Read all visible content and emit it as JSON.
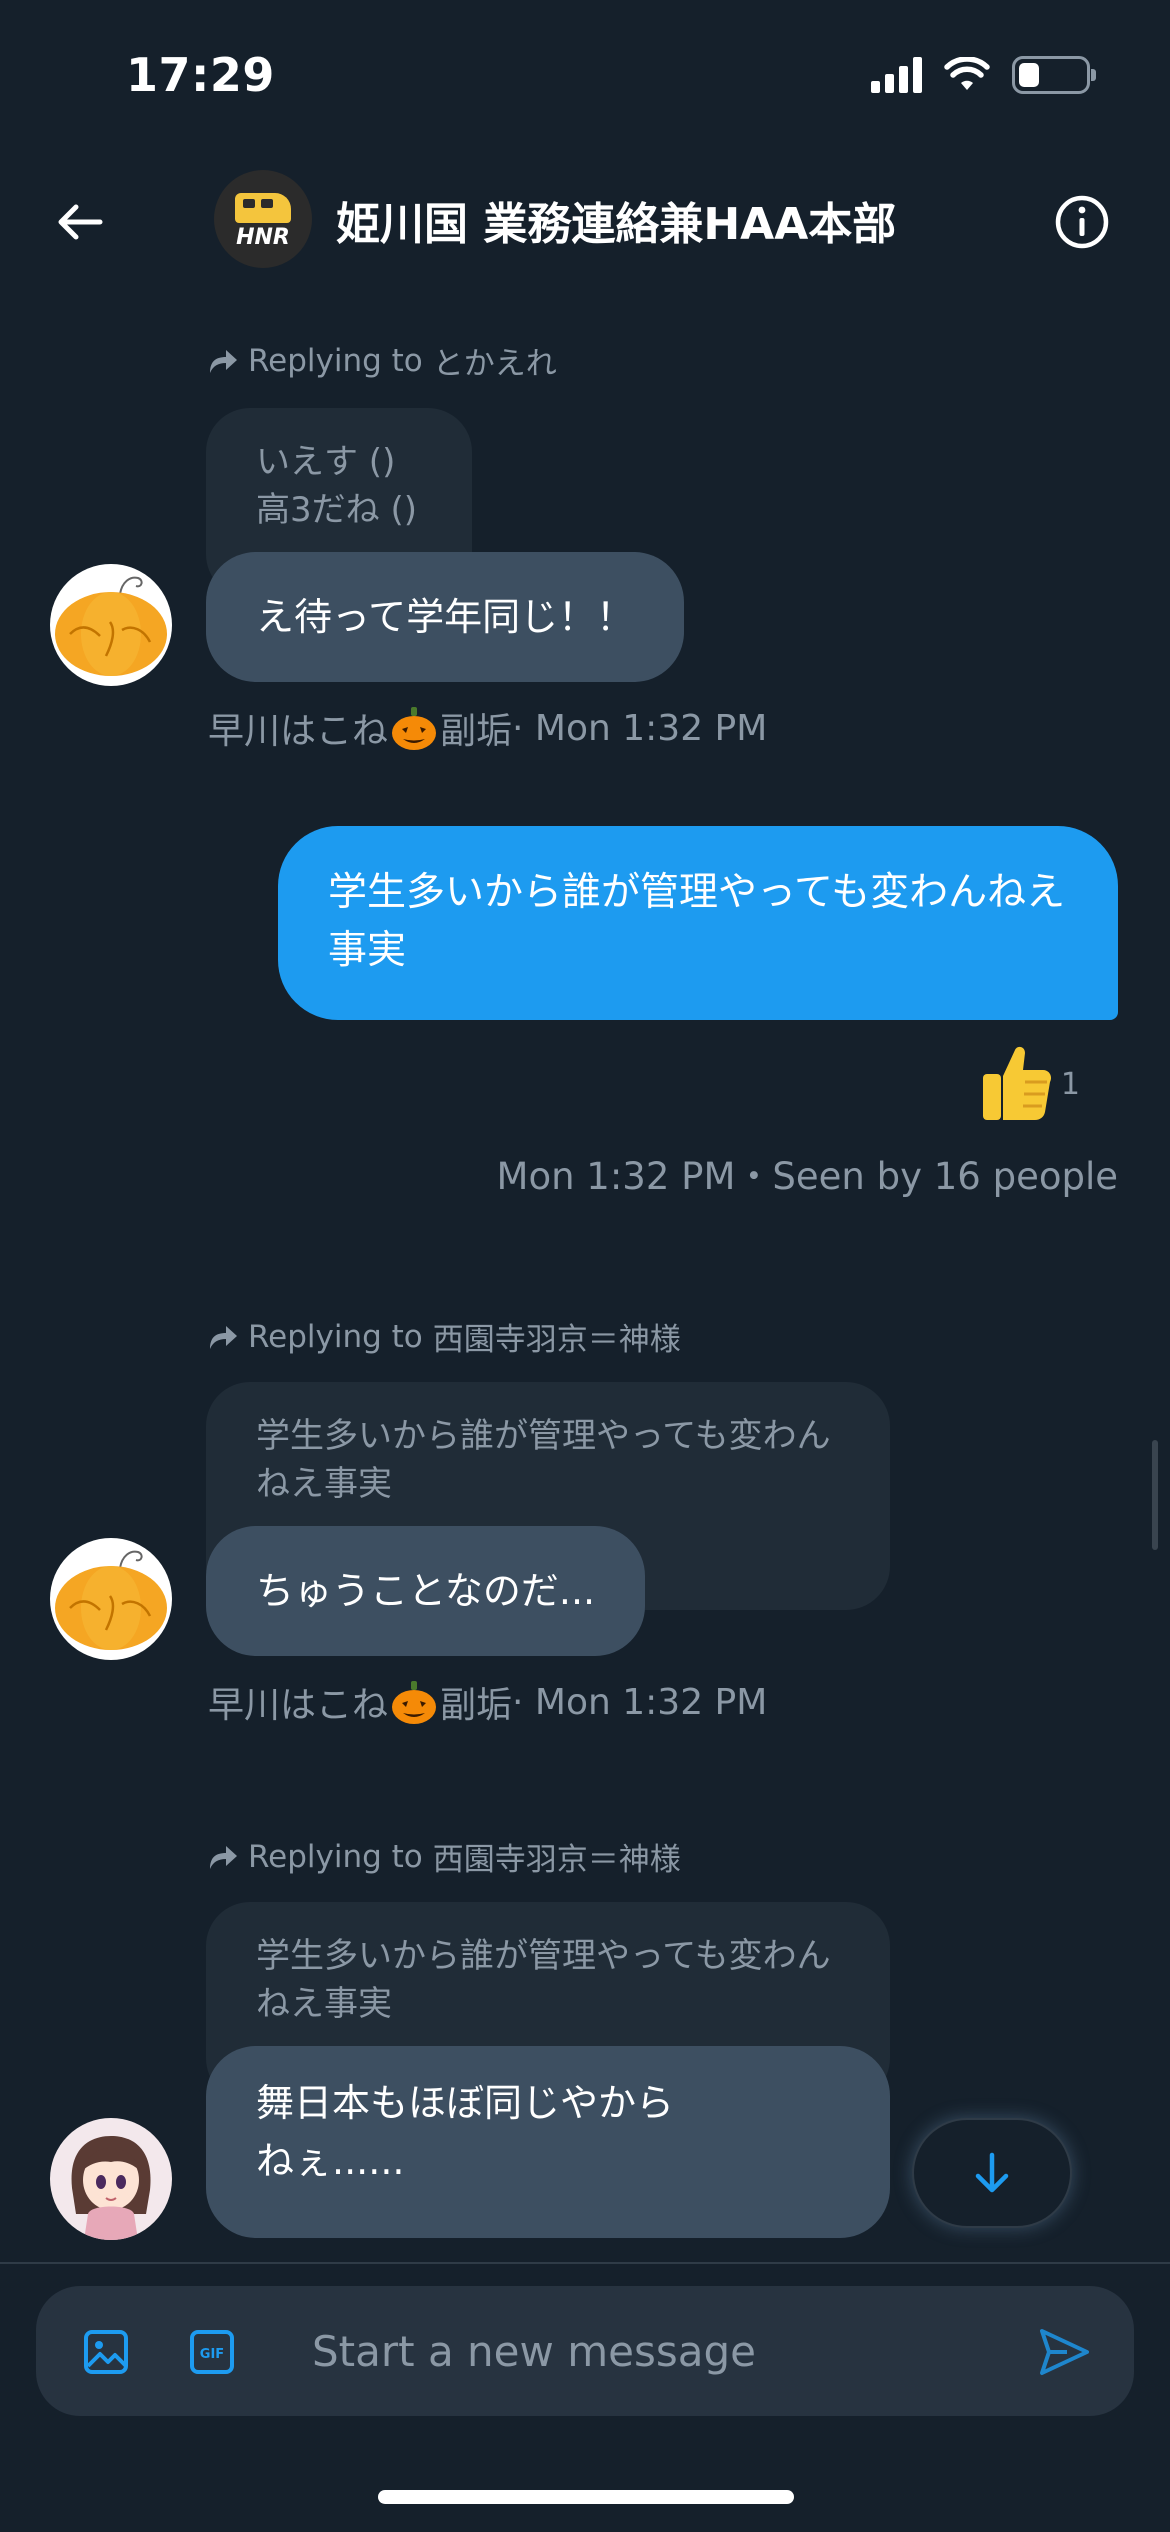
{
  "status_bar": {
    "time": "17:29"
  },
  "header": {
    "title": "姫川国 業務連絡兼HAA本部",
    "avatar_text": "HNR"
  },
  "messages": [
    {
      "replying_label": "Replying to",
      "replying_name": "とかえれ",
      "quote_lines": [
        "いえす ()",
        "高3だね ()"
      ],
      "text": "え待って学年同じ！！",
      "meta_name_before": "早川はこね",
      "meta_name_after": "副垢",
      "meta_time": " · Mon 1:32 PM"
    },
    {
      "outgoing": true,
      "text": "学生多いから誰が管理やっても変わんねえ事実",
      "reaction_count": "1",
      "seen": "Mon 1:32 PM・Seen by 16 people"
    },
    {
      "replying_label": "Replying to",
      "replying_name": "西園寺羽京＝神様",
      "quote_text": "学生多いから誰が管理やっても変わんねえ事実",
      "text": "ちゅうことなのだ...",
      "meta_name_before": "早川はこね",
      "meta_name_after": "副垢",
      "meta_time": " · Mon 1:32 PM"
    },
    {
      "replying_label": "Replying to",
      "replying_name": "西園寺羽京＝神様",
      "quote_text": "学生多いから誰が管理やっても変わんねえ事実",
      "text_lines": [
        "舞日本もほぼ同じやから",
        "ねぇ......"
      ]
    }
  ],
  "composer": {
    "placeholder": "Start a new message"
  },
  "icons": {
    "back": "arrow-left-icon",
    "info": "info-icon",
    "reply": "reply-arrow-icon",
    "image": "image-icon",
    "gif": "gif-icon",
    "send": "send-icon",
    "scroll_down": "arrow-down-icon",
    "reaction": "thumbs-up-icon",
    "pumpkin": "pumpkin-emoji"
  },
  "colors": {
    "background": "#15202b",
    "accent": "#1d9bf0",
    "incoming_bubble": "#3d4f61",
    "quote_bubble": "#202c37",
    "secondary_text": "#8b98a5"
  }
}
